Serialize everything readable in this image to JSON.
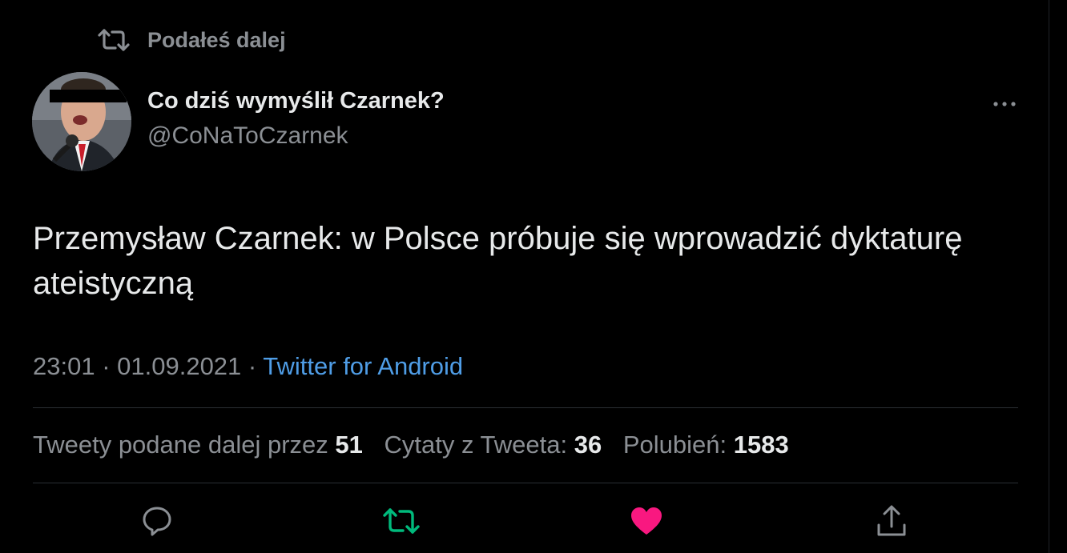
{
  "retweet_label": "Podałeś dalej",
  "author": {
    "name": "Co dziś wymyślił Czarnek?",
    "handle": "@CoNaToCzarnek"
  },
  "tweet_text": "Przemysław Czarnek: w Polsce próbuje się wprowadzić dyktaturę ateistyczną",
  "meta": {
    "time": "23:01",
    "sep1": " · ",
    "date": "01.09.2021",
    "sep2": " · ",
    "source": "Twitter for Android"
  },
  "stats": {
    "retweets_label": "Tweety podane dalej przez",
    "retweets": "51",
    "quotes_label": "Cytaty z Tweeta:",
    "quotes": "36",
    "likes_label": "Polubień:",
    "likes": "1583"
  },
  "colors": {
    "background": "#000000",
    "text": "#e7e9ea",
    "muted": "#8b8f94",
    "link": "#4f9de6",
    "retweet_green": "#00ba7c",
    "like_pink": "#f91880"
  },
  "icons": {
    "retweet": "retweet-icon",
    "more": "more-icon",
    "reply": "reply-icon",
    "like": "heart-icon",
    "share": "share-icon"
  }
}
